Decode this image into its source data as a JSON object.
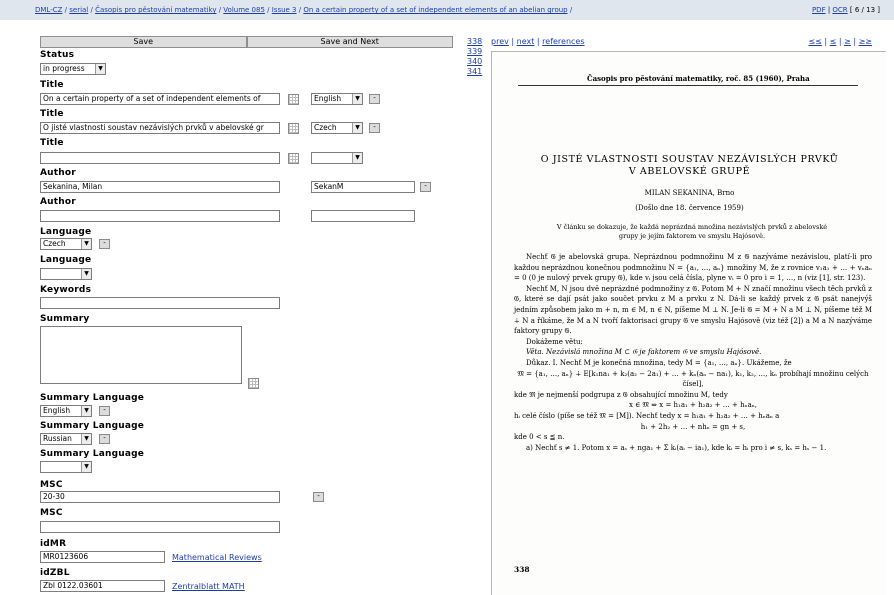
{
  "breadcrumb": {
    "items": [
      "DML-CZ",
      "serial",
      "Časopis pro pěstování matematiky",
      "Volume 085",
      "Issue 3",
      "On a certain property of a set of independent elements of an abelian group"
    ],
    "sep": " / ",
    "trail": " /"
  },
  "tools": {
    "pdf": "PDF",
    "ocr": "OCR",
    "pages": "[ 6 / 13 ]"
  },
  "buttons": {
    "save": "Save",
    "save_next": "Save and Next"
  },
  "form": {
    "status_label": "Status",
    "status_value": "in progress",
    "title_label": "Title",
    "title1_value": "On a certain property of a set of independent elements of",
    "title1_lang": "English",
    "title2_value": "O jisté vlastnosti soustav nezávislých prvků v abelovské gr",
    "title2_lang": "Czech",
    "title3_value": "",
    "title3_lang": "",
    "author_label": "Author",
    "author1_value": "Sekanina, Milan",
    "author1_code": "SekanM",
    "author2_value": "",
    "author2_code": "",
    "language_label": "Language",
    "language1_value": "Czech",
    "language2_value": "",
    "keywords_label": "Keywords",
    "keywords_value": "",
    "summary_label": "Summary",
    "summary_value": "",
    "summary_language_label": "Summary Language",
    "sumlang1_value": "English",
    "sumlang2_value": "Russian",
    "sumlang3_value": "",
    "msc_label": "MSC",
    "msc1_value": "20-30",
    "msc2_value": "",
    "idmr_label": "idMR",
    "idmr_value": "MR0123606",
    "idmr_link": "Mathematical Reviews",
    "idzbl_label": "idZBL",
    "idzbl_value": "Zbl 0122.03601",
    "idzbl_link": "Zentralblatt MATH",
    "mini_btn": "-"
  },
  "page_links": [
    "338",
    "339",
    "340",
    "341"
  ],
  "viewer_nav": {
    "prev": "prev",
    "next": "next",
    "references": "references",
    "sep": " | ",
    "first": "≤≤",
    "back": "≤",
    "fwd": "≥",
    "last": "≥≥"
  },
  "scan": {
    "running_head": "Časopis pro pěstování matematiky, roč. 85 (1960), Praha",
    "title_line1": "O JISTÉ VLASTNOSTI SOUSTAV NEZÁVISLÝCH PRVKŮ",
    "title_line2": "V ABELOVSKÉ GRUPĚ",
    "author": "MILAN SEKANINA, Brno",
    "received": "(Došlo dne 18. července 1959)",
    "abstract": "V článku se dokazuje, že každá neprázdná množina nezávislých prvků z abelovské grupy je jejím faktorem ve smyslu Hajósově.",
    "body": [
      "Nechť 𝔊 je abelovská grupa. Neprázdnou podmnožinu M z 𝔊 nazýváme nezávislou, platí-li pro každou neprázdnou konečnou podmnožinu N = {a₁, …, aₙ} množiny M, že z rovnice v₁a₁ + … + vₙaₙ = 0 (0 je nulový prvek grupy 𝔊), kde vᵢ jsou celá čísla, plyne vᵢ = 0 pro i = 1, …, n (viz [1], str. 123).",
      "Nechť M, N jsou dvě neprázdné podmnožiny z 𝔊. Potom M + N značí množinu všech těch prvků z 𝔊, které se dají psát jako součet prvku z M a prvku z N. Dá-li se každý prvek z 𝔊 psát nanejvýš jedním způsobem jako m + n, m ∈ M, n ∈ N, píšeme M ⊥ N. Je-li 𝔊 = M + N a M ⊥ N, píšeme též M ∔ N a říkáme, že M a N tvoří faktorisaci grupy 𝔊 ve smyslu Hajósově (viz též [2]) a M a N nazýváme faktory grupy 𝔊.",
      "Dokážeme větu:",
      "Věta. Nezávislá množina M ⊂ 𝔊 je faktorem 𝔊 ve smyslu Hajósově.",
      "Důkaz. I. Nechť M je konečná množina, tedy M = {a₁, …, aₙ}. Ukážeme, že",
      "𝔐 = {a₁, …, aₙ} ∔ E[k₁na₁ + k₂(a₂ − 2a₁) + … + kₙ(aₙ − na₁), k₁, k₂, …, kₙ probíhají množinu celých čísel],",
      "kde 𝔐 je nejmenší podgrupa z 𝔊 obsahující množinu M, tedy",
      "x ∈ 𝔐 ⇔ x = h₁a₁ + h₂a₂ + … + hₙaₙ,",
      "hᵢ celé číslo (píše se též 𝔐 = [M]). Nechť tedy x = h₁a₁ + h₂a₂ + … + hₙaₙ a",
      "h₁ + 2h₂ + … + nhₙ = gn + s,",
      "kde 0 < s ≦ n.",
      "a) Nechť s ≠ 1. Potom x = aₛ + nga₁ + Σ kᵢ(aᵢ − ia₁), kde kᵢ = hᵢ pro i ≠ s, kₛ = hₛ − 1."
    ],
    "page_number": "338"
  }
}
